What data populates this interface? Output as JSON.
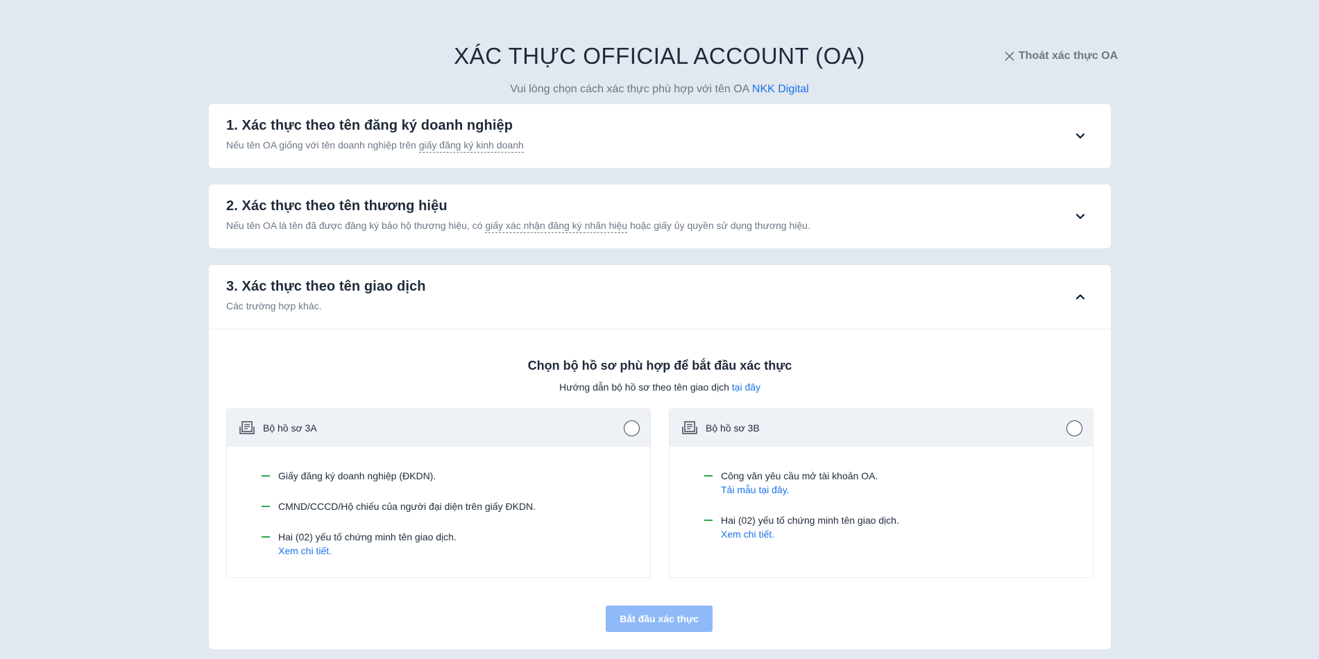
{
  "header": {
    "title": "XÁC THỰC OFFICIAL ACCOUNT (OA)",
    "subtitle_prefix": "Vui lòng chọn cách xác thực phù hợp với tên OA ",
    "oa_name": "NKK Digital",
    "exit_label": "Thoát xác thực OA"
  },
  "sections": [
    {
      "title": "1. Xác thực theo tên đăng ký doanh nghiệp",
      "desc_prefix": "Nếu tên OA giống với tên doanh nghiệp trên ",
      "desc_term": "giấy đăng ký kinh doanh",
      "desc_suffix": "",
      "expanded": false
    },
    {
      "title": "2. Xác thực theo tên thương hiệu",
      "desc_prefix": "Nếu tên OA là tên đã được đăng ký bảo hộ thương hiệu, có ",
      "desc_term": "giấy xác nhận đăng ký nhãn hiệu",
      "desc_suffix": " hoặc giấy ủy quyền sử dụng thương hiệu.",
      "expanded": false
    },
    {
      "title": "3. Xác thực theo tên giao dịch",
      "desc": "Các trường hợp khác.",
      "expanded": true,
      "body": {
        "title": "Chọn bộ hồ sơ phù hợp để bắt đầu xác thực",
        "guide_prefix": "Hướng dẫn bộ hồ sơ theo tên giao dịch ",
        "guide_link": "tại đây",
        "packages": [
          {
            "name": "Bộ hồ sơ 3A",
            "items": [
              {
                "text": "Giấy đăng ký doanh nghiệp (ĐKDN).",
                "link": ""
              },
              {
                "text": "CMND/CCCD/Hộ chiếu của người đại diện trên giấy ĐKDN.",
                "link": ""
              },
              {
                "text": "Hai (02) yếu tố chứng minh tên giao dịch.",
                "link": "Xem chi tiết."
              }
            ]
          },
          {
            "name": "Bộ hồ sơ 3B",
            "items": [
              {
                "text": "Công văn yêu cầu mở tài khoản OA.",
                "link": "Tải mẫu tại đây."
              },
              {
                "text": "Hai (02) yếu tố chứng minh tên giao dịch.",
                "link": "Xem chi tiết."
              }
            ]
          }
        ],
        "start_button": "Bắt đầu xác thực"
      }
    }
  ],
  "icons": {
    "exit": "close-icon",
    "collapsed": "chevron-down-icon",
    "expanded": "chevron-up-icon",
    "package": "document-icon"
  },
  "colors": {
    "background": "#e1e8ef",
    "link": "#1a73e8",
    "bullet": "#2ba84a",
    "button_disabled": "#8fb9f8"
  }
}
